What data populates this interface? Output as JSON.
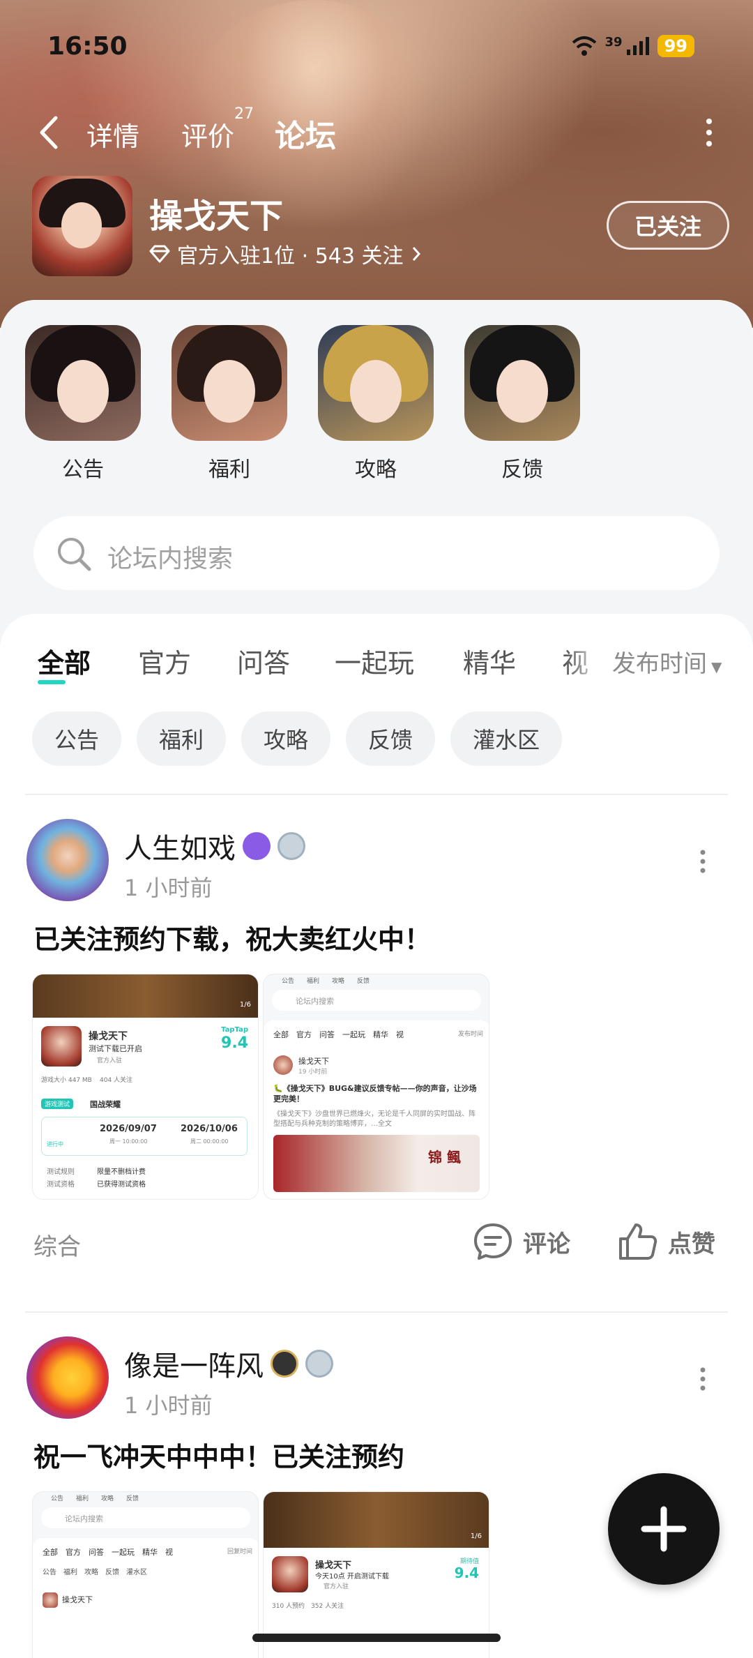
{
  "status_bar": {
    "time": "16:50",
    "network": "39",
    "battery": "99"
  },
  "nav": {
    "tabs": [
      {
        "label": "详情"
      },
      {
        "label": "评价",
        "badge": "27"
      },
      {
        "label": "论坛"
      }
    ]
  },
  "game": {
    "name": "操戈天下",
    "meta": "官方入驻1位 · 543 关注",
    "follow_label": "已关注"
  },
  "shortcuts": [
    {
      "label": "公告"
    },
    {
      "label": "福利"
    },
    {
      "label": "攻略"
    },
    {
      "label": "反馈"
    }
  ],
  "search": {
    "placeholder": "论坛内搜索"
  },
  "filter_tabs": [
    {
      "label": "全部"
    },
    {
      "label": "官方"
    },
    {
      "label": "问答"
    },
    {
      "label": "一起玩"
    },
    {
      "label": "精华"
    },
    {
      "label": "视"
    }
  ],
  "sort": {
    "label": "发布时间"
  },
  "chips": [
    {
      "label": "公告"
    },
    {
      "label": "福利"
    },
    {
      "label": "攻略"
    },
    {
      "label": "反馈"
    },
    {
      "label": "灌水区"
    }
  ],
  "posts": [
    {
      "user": "人生如戏",
      "time": "1 小时前",
      "title": "已关注预约下载，祝大卖红火中！",
      "category": "综合",
      "comment_label": "评论",
      "like_label": "点赞",
      "thumb1": {
        "counter": "1/6",
        "game": "操戈天下",
        "sub": "测试下载已开启",
        "official": "官方入驻",
        "score_brand": "TapTap",
        "score": "9.4",
        "size": "游戏大小 447 MB",
        "follows": "404 人关注",
        "test_tag": "游戏测试",
        "test_name": "国战荣耀",
        "status": "进行中",
        "date_start": "2026/09/07",
        "date_start_sub": "周一 10:00:00",
        "date_end": "2026/10/06",
        "date_end_sub": "周二 00:00:00",
        "rule_k1": "测试规则",
        "rule_v1": "限量不删档计费",
        "rule_k2": "测试资格",
        "rule_v2": "已获得测试资格"
      },
      "thumb2": {
        "tabs": "公告　　福利　　攻略　　反馈",
        "search": "论坛内搜索",
        "ftabs": "全部　官方　问答　一起玩　精华　视",
        "sort": "发布时间",
        "game": "操戈天下",
        "time": "19 小时前",
        "title": "🐛《操戈天下》BUG&建议反馈专帖——你的声音，让沙场更完美！",
        "body": "《操戈天下》沙盘世界已燃烽火，无论是千人同屏的实时国战、阵型搭配与兵种克制的策略博弈，…全文",
        "banner": "锦 鲺"
      }
    },
    {
      "user": "像是一阵风",
      "time": "1 小时前",
      "title": "祝一飞冲天中中中！已关注预约",
      "thumb1": {
        "tabs": "公告　　福利　　攻略　　反馈",
        "search": "论坛内搜索",
        "ftabs": "全部　官方　问答　一起玩　精华　视",
        "sort": "回复时间",
        "chips": "公告　福利　攻略　反馈　灌水区",
        "game": "操戈天下"
      },
      "thumb2": {
        "counter": "1/6",
        "game": "操戈天下",
        "sub": "今天10点 开启测试下载",
        "official": "官方入驻",
        "score_brand": "期待值",
        "score": "9.4",
        "stats": "310 人预约　352 人关注"
      }
    }
  ],
  "colors": {
    "accent": "#20d6c4",
    "battery": "#f5b800",
    "fab": "#141414"
  }
}
